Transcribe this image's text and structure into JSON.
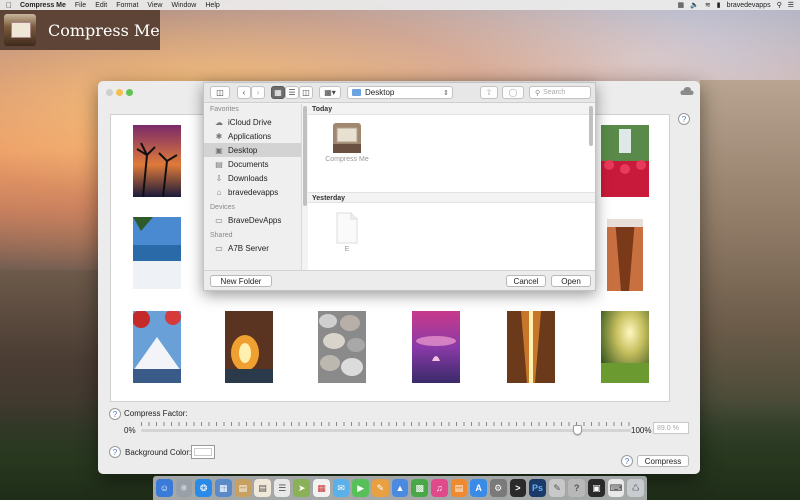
{
  "menubar": {
    "app_name": "Compress Me",
    "items": [
      "File",
      "Edit",
      "Format",
      "View",
      "Window",
      "Help"
    ],
    "user": "bravedevapps"
  },
  "app_tile": {
    "title": "Compress Me"
  },
  "dialog": {
    "path": "Desktop",
    "search_placeholder": "Search",
    "sidebar": {
      "favorites_header": "Favorites",
      "favorites": [
        {
          "label": "iCloud Drive",
          "icon": "cloud-icon"
        },
        {
          "label": "Applications",
          "icon": "applications-icon"
        },
        {
          "label": "Desktop",
          "icon": "desktop-icon",
          "selected": true
        },
        {
          "label": "Documents",
          "icon": "document-icon"
        },
        {
          "label": "Downloads",
          "icon": "download-icon"
        },
        {
          "label": "bravedevapps",
          "icon": "home-icon"
        }
      ],
      "devices_header": "Devices",
      "devices": [
        {
          "label": "BraveDevApps",
          "icon": "laptop-icon"
        }
      ],
      "shared_header": "Shared",
      "shared": [
        {
          "label": "A7B Server",
          "icon": "server-icon"
        }
      ]
    },
    "groups": [
      {
        "header": "Today",
        "items": [
          {
            "name": "Compress Me",
            "icon": "compress-me-app-icon"
          }
        ]
      },
      {
        "header": "Yesterday",
        "items": [
          {
            "name": "E",
            "icon": "text-file-icon"
          }
        ]
      }
    ],
    "new_folder_label": "New Folder",
    "cancel_label": "Cancel",
    "open_label": "Open"
  },
  "controls": {
    "compress_factor_label": "Compress Factor:",
    "min_label": "0%",
    "max_label": "100%",
    "factor_value": "89.0 %",
    "slider_fraction": 0.89,
    "background_color_label": "Background Color:",
    "background_color": "#ffffff",
    "compress_label": "Compress",
    "help_symbol": "?"
  },
  "colors": {
    "selection": "#d3d3d3",
    "accent_blue": "#4a76c8",
    "traffic_yellow": "#f5be4f",
    "traffic_green": "#60c454"
  }
}
